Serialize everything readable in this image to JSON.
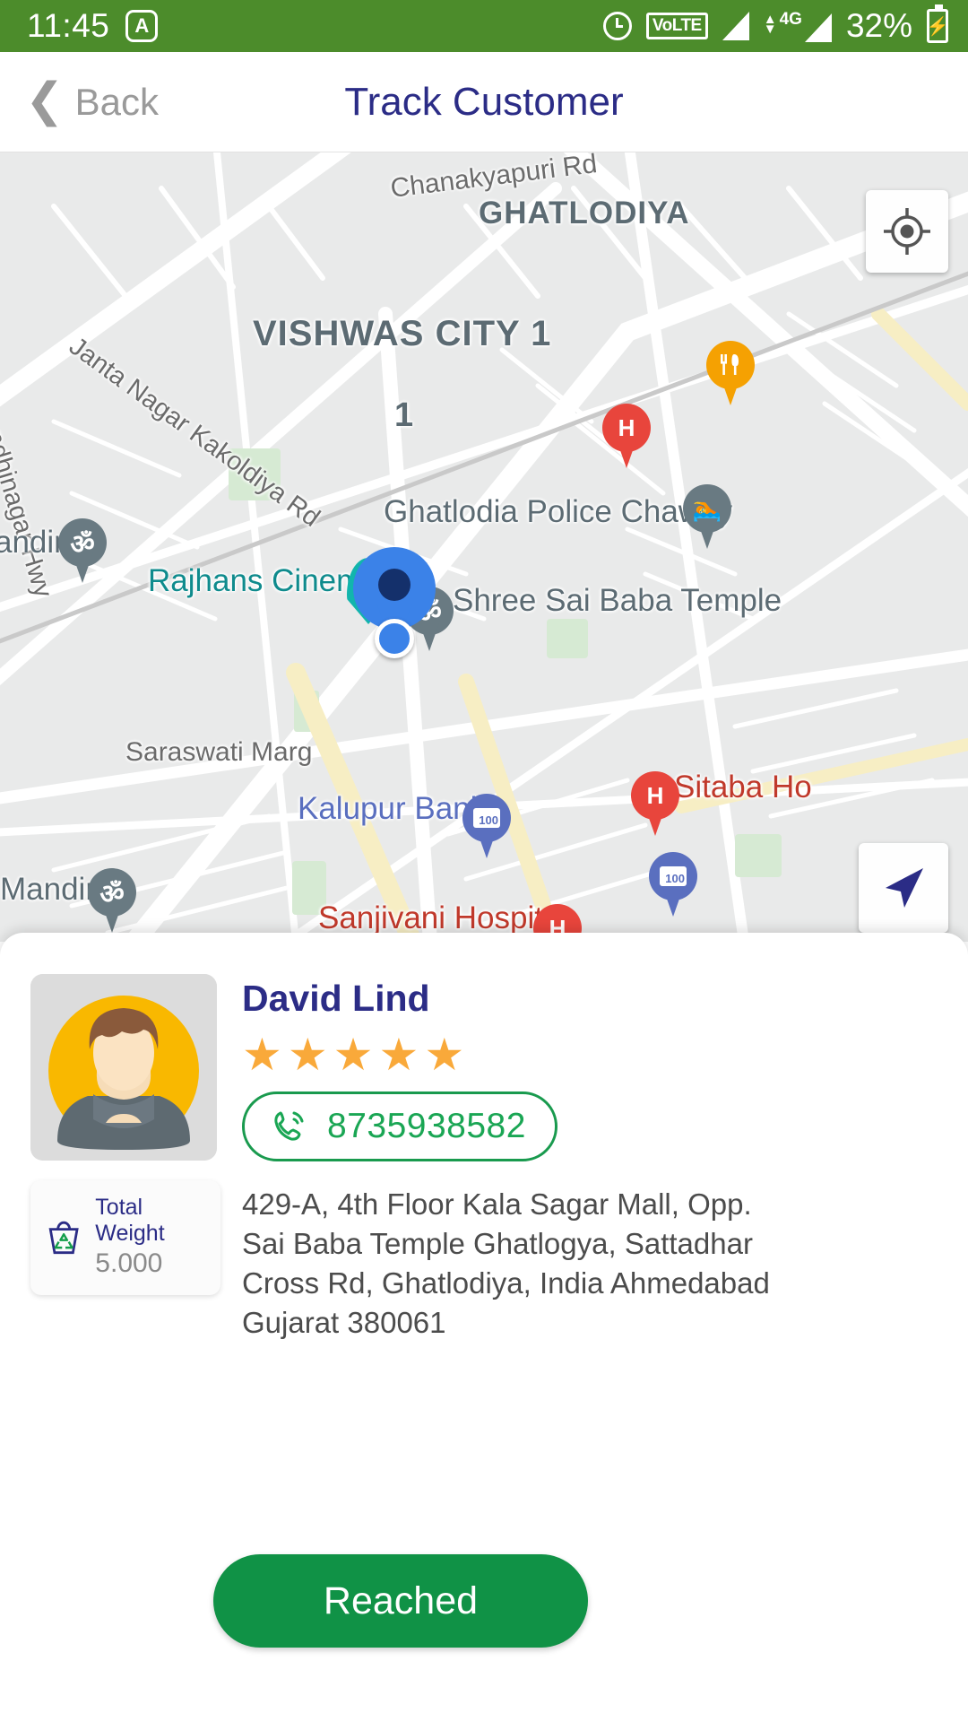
{
  "status_bar": {
    "time": "11:45",
    "app_logo": "A",
    "alarm_icon": "alarm-icon",
    "volte_label": "VoLTE",
    "network_label": "4G",
    "battery_percent": "32%"
  },
  "header": {
    "back_label": "Back",
    "title": "Track Customer"
  },
  "map": {
    "labels": [
      {
        "text": "Chanakyapuri Rd",
        "kind": "road"
      },
      {
        "text": "GHATLODIYA",
        "kind": "area"
      },
      {
        "text": "VISHWAS CITY 1",
        "kind": "area"
      },
      {
        "text": "1",
        "kind": "area"
      },
      {
        "text": "Sarkhej - Gandhinagar Hwy",
        "kind": "road"
      },
      {
        "text": "Janta Nagar Kakoldiya Rd",
        "kind": "road"
      },
      {
        "text": "Ghatlodia Police Chawky",
        "kind": "poi-grey"
      },
      {
        "text": "Rajhans Cinema",
        "kind": "poi-teal"
      },
      {
        "text": "Shree Sai Baba Temple",
        "kind": "poi-grey"
      },
      {
        "text": "andir",
        "kind": "poi-grey"
      },
      {
        "text": "Mandir",
        "kind": "poi-grey"
      },
      {
        "text": "Saraswati Marg",
        "kind": "road"
      },
      {
        "text": "Kalupur Bank",
        "kind": "poi-blue"
      },
      {
        "text": "Sanjivani Hospital",
        "kind": "poi-red"
      },
      {
        "text": "Sitaba Ho",
        "kind": "poi-red"
      }
    ],
    "pins": [
      {
        "name": "hospital-pin",
        "glyph": "H",
        "color": "#e8453c"
      },
      {
        "name": "restaurant-pin",
        "glyph": "🍴",
        "color": "#f5a102"
      },
      {
        "name": "temple-pin",
        "glyph": "ॐ",
        "color": "#697a82"
      },
      {
        "name": "atm-pin",
        "glyph": "100",
        "color": "#5a6fbf"
      }
    ],
    "locate_button": "my-location-icon",
    "navigate_button": "navigation-arrow-icon",
    "destination_marker": "destination-pin",
    "current_location_marker": "current-location-dot"
  },
  "customer": {
    "name": "David Lind",
    "rating": 5,
    "rating_max": 5,
    "star_glyph": "★",
    "phone": "8735938582",
    "phone_icon": "phone-call-icon",
    "address": "429-A, 4th Floor Kala Sagar Mall,  Opp. Sai Baba Temple Ghatlogya,  Sattadhar Cross Rd, Ghatlodiya,  India Ahmedabad Gujarat 380061",
    "total_weight_label": "Total Weight",
    "total_weight_value": "5.000",
    "weight_icon": "recycle-basket-icon"
  },
  "actions": {
    "primary_button": "Reached"
  },
  "colors": {
    "status_bar_green": "#4c8c2b",
    "title_navy": "#2b2c86",
    "button_green": "#109246",
    "phone_green": "#1aa654",
    "star_orange": "#f9a93a"
  }
}
